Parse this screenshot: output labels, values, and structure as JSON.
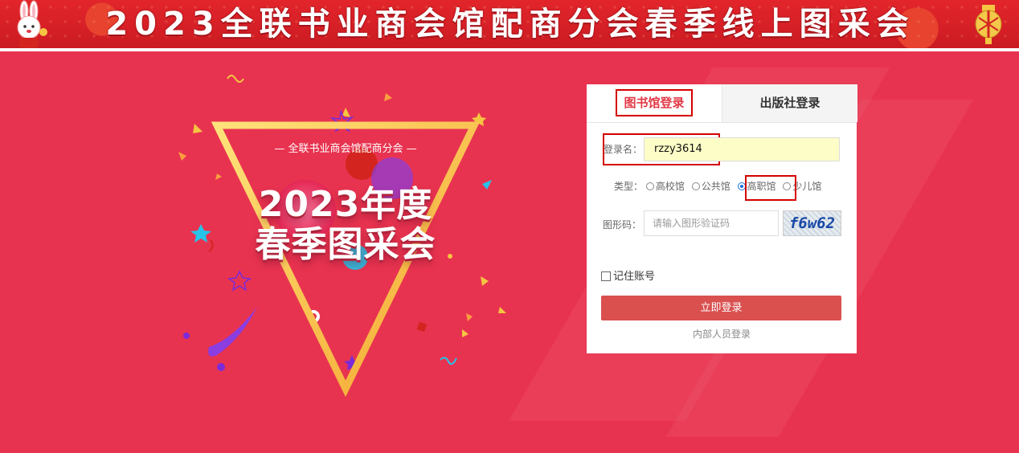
{
  "banner": {
    "title": "2023全联书业商会馆配商分会春季线上图采会"
  },
  "hero": {
    "subtitle": "— 全联书业商会馆配商分会 —",
    "title_line1": "2023年度",
    "title_line2": "春季图采会"
  },
  "login": {
    "tabs": [
      {
        "label": "图书馆登录",
        "active": true
      },
      {
        "label": "出版社登录",
        "active": false
      }
    ],
    "username": {
      "label": "登录名：",
      "value": "rzzy3614"
    },
    "type": {
      "label": "类型：",
      "options": [
        {
          "label": "高校馆",
          "checked": false
        },
        {
          "label": "公共馆",
          "checked": false
        },
        {
          "label": "高职馆",
          "checked": true
        },
        {
          "label": "少儿馆",
          "checked": false
        }
      ]
    },
    "captcha": {
      "label": "图形码：",
      "placeholder": "请输入图形验证码",
      "image_text": "f6w62"
    },
    "remember_label": "记住账号",
    "submit_label": "立即登录",
    "internal_link": "内部人员登录"
  },
  "colors": {
    "background": "#e83350",
    "banner": "#d51f26",
    "accent": "#e23a46",
    "button": "#d9504f",
    "highlight_box": "#d40000"
  }
}
